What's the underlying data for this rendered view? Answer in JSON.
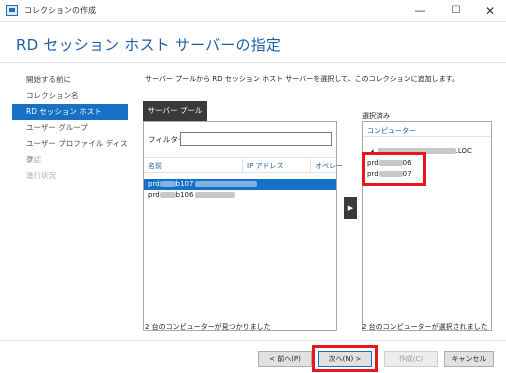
{
  "window": {
    "title": "コレクションの作成",
    "minimize_glyph": "—",
    "maximize_glyph": "☐",
    "close_glyph": "✕"
  },
  "page_heading": "RD セッション ホスト サーバーの指定",
  "nav": {
    "items": [
      {
        "label": "開始する前に",
        "state": "normal"
      },
      {
        "label": "コレクション名",
        "state": "normal"
      },
      {
        "label": "RD セッション ホスト",
        "state": "active"
      },
      {
        "label": "ユーザー グループ",
        "state": "normal"
      },
      {
        "label": "ユーザー プロファイル ディスク",
        "state": "normal"
      },
      {
        "label": "確認",
        "state": "disabled"
      },
      {
        "label": "進行状況",
        "state": "disabled"
      }
    ]
  },
  "instruction": "サーバー プールから RD セッション ホスト サーバーを選択して、このコレクションに追加します。",
  "server_pool": {
    "tab_label": "サーバー プール",
    "filter_label": "フィルター:",
    "filter_value": "",
    "columns": [
      "名前",
      "IP アドレス",
      "オペレー"
    ],
    "rows": [
      {
        "prefix": "prd",
        "suffix": "b107",
        "selected": true
      },
      {
        "prefix": "prd",
        "suffix": "b106",
        "selected": false
      }
    ],
    "status": "2 台のコンピューターが見つかりました"
  },
  "add_button_glyph": "▶",
  "selected": {
    "label": "選択済み",
    "column": "コンピューター",
    "domain_suffix": ".LOC",
    "items": [
      {
        "prefix": "prd",
        "suffix": "06"
      },
      {
        "prefix": "prd",
        "suffix": "07"
      }
    ],
    "status": "2 台のコンピューターが選択されました"
  },
  "buttons": {
    "prev": "< 前へ(P)",
    "next": "次へ(N) >",
    "create": "作成(C)",
    "cancel": "キャンセル"
  },
  "colors": {
    "accent": "#1670c5",
    "heading": "#1f5fa8",
    "highlight": "#e8171e",
    "tab_bg": "#3a3a3a"
  }
}
